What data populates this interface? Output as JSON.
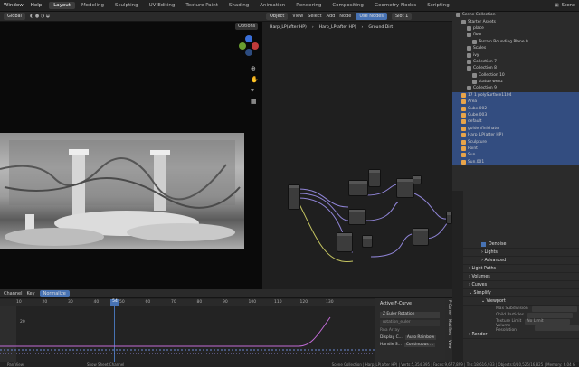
{
  "topbar": {
    "menus": [
      "Window",
      "Help"
    ],
    "workspaces": [
      "Layout",
      "Modeling",
      "Sculpting",
      "UV Editing",
      "Texture Paint",
      "Shading",
      "Animation",
      "Rendering",
      "Compositing",
      "Geometry Nodes",
      "Scripting"
    ],
    "active_workspace": "Layout",
    "scene": "Scene"
  },
  "viewport": {
    "orientation": "Global",
    "options": "Options"
  },
  "node_editor": {
    "menus": [
      "View",
      "Select",
      "Add",
      "Node"
    ],
    "object_type": "Object",
    "use_nodes": "Use Nodes",
    "slot": "Slot 1",
    "breadcrumb": [
      "Harp_LP(after HP)",
      "Harp_LP(after HP)",
      "Ground Dirt"
    ]
  },
  "outliner": {
    "rows": [
      {
        "label": "Scene Collection",
        "sel": false,
        "depth": 0
      },
      {
        "label": "Starter Assets",
        "sel": false,
        "depth": 1
      },
      {
        "label": "place",
        "sel": false,
        "depth": 2
      },
      {
        "label": "floor",
        "sel": false,
        "depth": 2
      },
      {
        "label": "Terrain Bounding Plane 0",
        "sel": false,
        "depth": 3
      },
      {
        "label": "Scales",
        "sel": false,
        "depth": 2
      },
      {
        "label": "ivy",
        "sel": false,
        "depth": 2
      },
      {
        "label": "Collection 7",
        "sel": false,
        "depth": 2
      },
      {
        "label": "Collection 8",
        "sel": false,
        "depth": 2
      },
      {
        "label": "Collection 10",
        "sel": false,
        "depth": 3
      },
      {
        "label": "statue wenz",
        "sel": false,
        "depth": 3
      },
      {
        "label": "Collection 9",
        "sel": false,
        "depth": 2
      },
      {
        "label": "17 1 polySurface1104",
        "sel": true,
        "depth": 1
      },
      {
        "label": "Area",
        "sel": true,
        "depth": 1
      },
      {
        "label": "Cube.002",
        "sel": true,
        "depth": 1
      },
      {
        "label": "Cube.003",
        "sel": true,
        "depth": 1
      },
      {
        "label": "default",
        "sel": true,
        "depth": 1
      },
      {
        "label": "goldenfinishater",
        "sel": true,
        "depth": 1
      },
      {
        "label": "Harp_LP(after HP)",
        "sel": true,
        "depth": 1
      },
      {
        "label": "Sculpture",
        "sel": true,
        "depth": 1
      },
      {
        "label": "Point",
        "sel": true,
        "depth": 1
      },
      {
        "label": "Sun",
        "sel": true,
        "depth": 1
      },
      {
        "label": "Sun.001",
        "sel": true,
        "depth": 1
      }
    ]
  },
  "props": {
    "rows": [
      "Denoise",
      "Lights",
      "Advanced",
      "Light Paths",
      "Volumes",
      "Curves",
      "Simplify",
      "Viewport"
    ],
    "fields": [
      {
        "label": "Max Subdivision",
        "value": ""
      },
      {
        "label": "Child Particles",
        "value": ""
      },
      {
        "label": "Texture Limit",
        "value": "No Limit"
      },
      {
        "label": "Volume Resolution",
        "value": ""
      }
    ],
    "footer": "Render"
  },
  "timeline": {
    "menus": [
      "Channel",
      "Key"
    ],
    "mode": "Normalize",
    "frames": [
      "10",
      "20",
      "30",
      "40",
      "50",
      "60",
      "70",
      "80",
      "90",
      "100",
      "110",
      "120",
      "130"
    ],
    "current_frame": "54",
    "value_label": "20"
  },
  "fcurve": {
    "title": "Active F-Curve",
    "channel": "Z Euler Rotation",
    "rna_path": "rotation_euler",
    "rna_array": "Rna Array",
    "display_color": "Display C...",
    "display_value": "Auto Rainbow",
    "handle_label": "Handle S...",
    "handle_value": "Continuous ...",
    "tabs": [
      "F-Curve",
      "Modifiers",
      "View"
    ]
  },
  "status": [
    "Pan View",
    "Show Sheet Channel",
    "Scene Collection | Harp_LP(after HP) | Verts:5,354,395 | Faces:9,677,899 | Tris:18,616,933 | Objects:0/10,525/16,825 | Memory: 6.04 G"
  ]
}
